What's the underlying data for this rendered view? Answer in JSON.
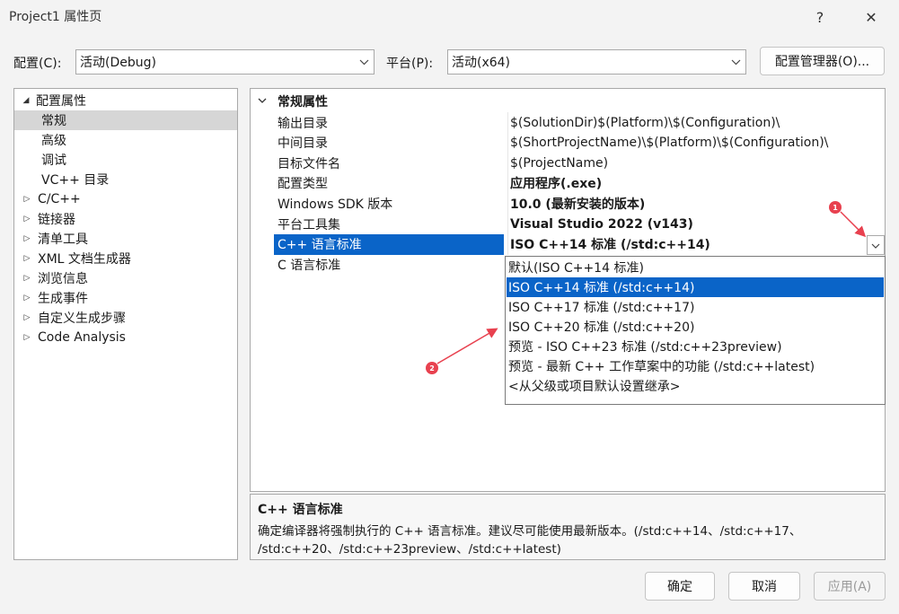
{
  "window": {
    "title": "Project1 属性页",
    "help": "?",
    "close": "✕"
  },
  "config_bar": {
    "config_label": "配置(C):",
    "config_value": "活动(Debug)",
    "platform_label": "平台(P):",
    "platform_value": "活动(x64)",
    "manager_button": "配置管理器(O)..."
  },
  "tree": {
    "root": "配置属性",
    "items": [
      {
        "label": "常规",
        "expandable": false,
        "selected": true
      },
      {
        "label": "高级",
        "expandable": false
      },
      {
        "label": "调试",
        "expandable": false
      },
      {
        "label": "VC++ 目录",
        "expandable": false
      },
      {
        "label": "C/C++",
        "expandable": true
      },
      {
        "label": "链接器",
        "expandable": true
      },
      {
        "label": "清单工具",
        "expandable": true
      },
      {
        "label": "XML 文档生成器",
        "expandable": true
      },
      {
        "label": "浏览信息",
        "expandable": true
      },
      {
        "label": "生成事件",
        "expandable": true
      },
      {
        "label": "自定义生成步骤",
        "expandable": true
      },
      {
        "label": "Code Analysis",
        "expandable": true
      }
    ]
  },
  "grid": {
    "section": "常规属性",
    "rows": [
      {
        "name": "输出目录",
        "value": "$(SolutionDir)$(Platform)\\$(Configuration)\\",
        "bold": false
      },
      {
        "name": "中间目录",
        "value": "$(ShortProjectName)\\$(Platform)\\$(Configuration)\\",
        "bold": false
      },
      {
        "name": "目标文件名",
        "value": "$(ProjectName)",
        "bold": false
      },
      {
        "name": "配置类型",
        "value": "应用程序(.exe)",
        "bold": true
      },
      {
        "name": "Windows SDK 版本",
        "value": "10.0 (最新安装的版本)",
        "bold": true
      },
      {
        "name": "平台工具集",
        "value": "Visual Studio 2022 (v143)",
        "bold": true
      },
      {
        "name": "C++ 语言标准",
        "value": "ISO C++14 标准 (/std:c++14)",
        "bold": true
      },
      {
        "name": "C 语言标准",
        "value": "",
        "bold": false
      }
    ]
  },
  "dropdown": {
    "options": [
      "默认(ISO C++14 标准)",
      "ISO C++14 标准 (/std:c++14)",
      "ISO C++17 标准 (/std:c++17)",
      "ISO C++20 标准 (/std:c++20)",
      "预览 - ISO C++23 标准 (/std:c++23preview)",
      "预览 - 最新 C++ 工作草案中的功能 (/std:c++latest)",
      "<从父级或项目默认设置继承>"
    ],
    "selected_index": 1
  },
  "annotations": {
    "marker1": "1",
    "marker2": "2",
    "color": "#e8414f"
  },
  "description": {
    "title": "C++ 语言标准",
    "line1": "确定编译器将强制执行的 C++ 语言标准。建议尽可能使用最新版本。(/std:c++14、/std:c++17、",
    "line2": "/std:c++20、/std:c++23preview、/std:c++latest)"
  },
  "buttons": {
    "ok": "确定",
    "cancel": "取消",
    "apply": "应用(A)"
  }
}
